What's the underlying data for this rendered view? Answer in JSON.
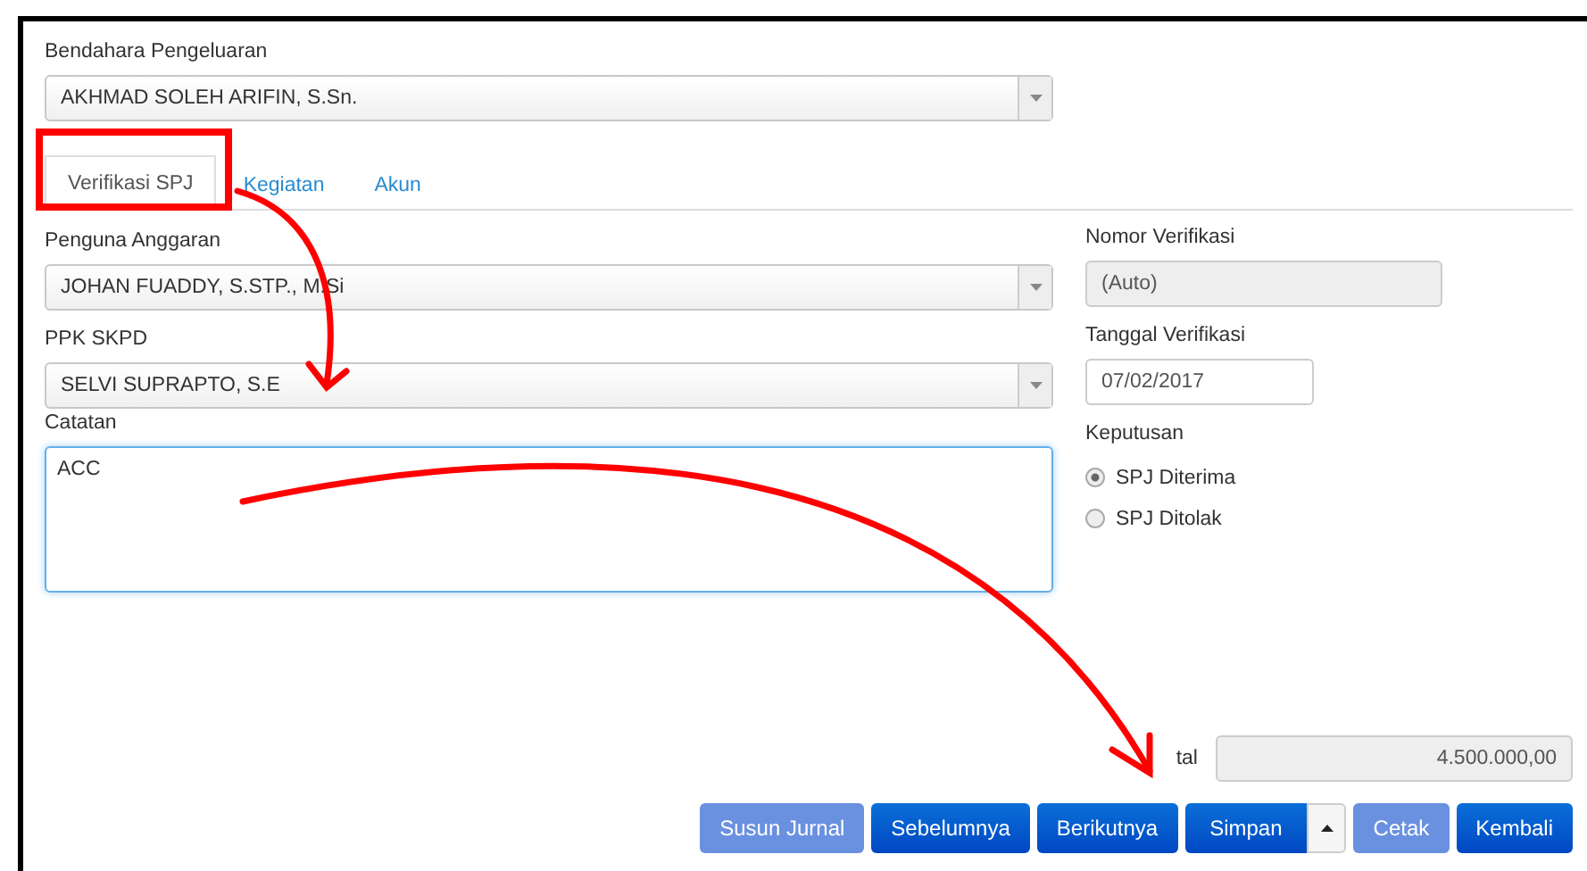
{
  "fields": {
    "bendahara": {
      "label": "Bendahara Pengeluaran",
      "value": "AKHMAD SOLEH ARIFIN, S.Sn."
    },
    "tabs": [
      {
        "label": "Verifikasi SPJ",
        "selected": true
      },
      {
        "label": "Kegiatan",
        "selected": false
      },
      {
        "label": "Akun",
        "selected": false
      }
    ],
    "left": [
      {
        "label": "Penguna Anggaran",
        "value": "JOHAN FUADDY, S.STP., M.Si"
      },
      {
        "label": "PPK SKPD",
        "value": "SELVI SUPRAPTO, S.E"
      }
    ],
    "catatan": {
      "label": "Catatan",
      "value": "ACC"
    },
    "nomor": {
      "label": "Nomor Verifikasi",
      "value": "(Auto)"
    },
    "tanggal": {
      "label": "Tanggal Verifikasi",
      "value": "07/02/2017"
    },
    "keputusan": {
      "label": "Keputusan",
      "options": [
        {
          "label": "SPJ Diterima",
          "selected": true
        },
        {
          "label": "SPJ Ditolak",
          "selected": false
        }
      ]
    },
    "total": {
      "label": "tal",
      "value": "4.500.000,00"
    }
  },
  "buttons": [
    {
      "label": "Susun Jurnal",
      "disabled": true
    },
    {
      "label": "Sebelumnya",
      "disabled": false
    },
    {
      "label": "Berikutnya",
      "disabled": false
    },
    {
      "label": "Simpan",
      "disabled": false,
      "kind": "split"
    },
    {
      "label": "Cetak",
      "disabled": true
    },
    {
      "label": "Kembali",
      "disabled": false
    }
  ]
}
